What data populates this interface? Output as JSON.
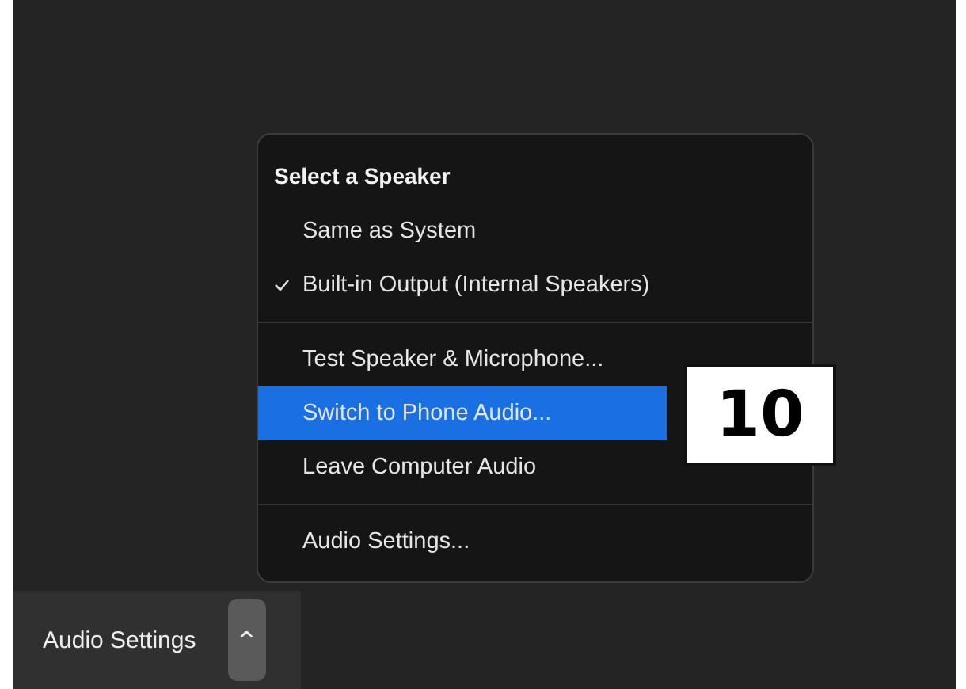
{
  "menu": {
    "header": "Select a Speaker",
    "sections": [
      {
        "items": [
          {
            "label": "Same as System",
            "checked": false,
            "selected": false
          },
          {
            "label": "Built-in Output (Internal Speakers)",
            "checked": true,
            "selected": false
          }
        ]
      },
      {
        "items": [
          {
            "label": "Test Speaker & Microphone...",
            "checked": false,
            "selected": false
          },
          {
            "label": "Switch to Phone Audio...",
            "checked": false,
            "selected": true
          },
          {
            "label": "Leave Computer Audio",
            "checked": false,
            "selected": false
          }
        ]
      },
      {
        "items": [
          {
            "label": "Audio Settings...",
            "checked": false,
            "selected": false
          }
        ]
      }
    ]
  },
  "step_badge": "10",
  "toolbar": {
    "label": "Audio Settings",
    "caret": "^"
  }
}
